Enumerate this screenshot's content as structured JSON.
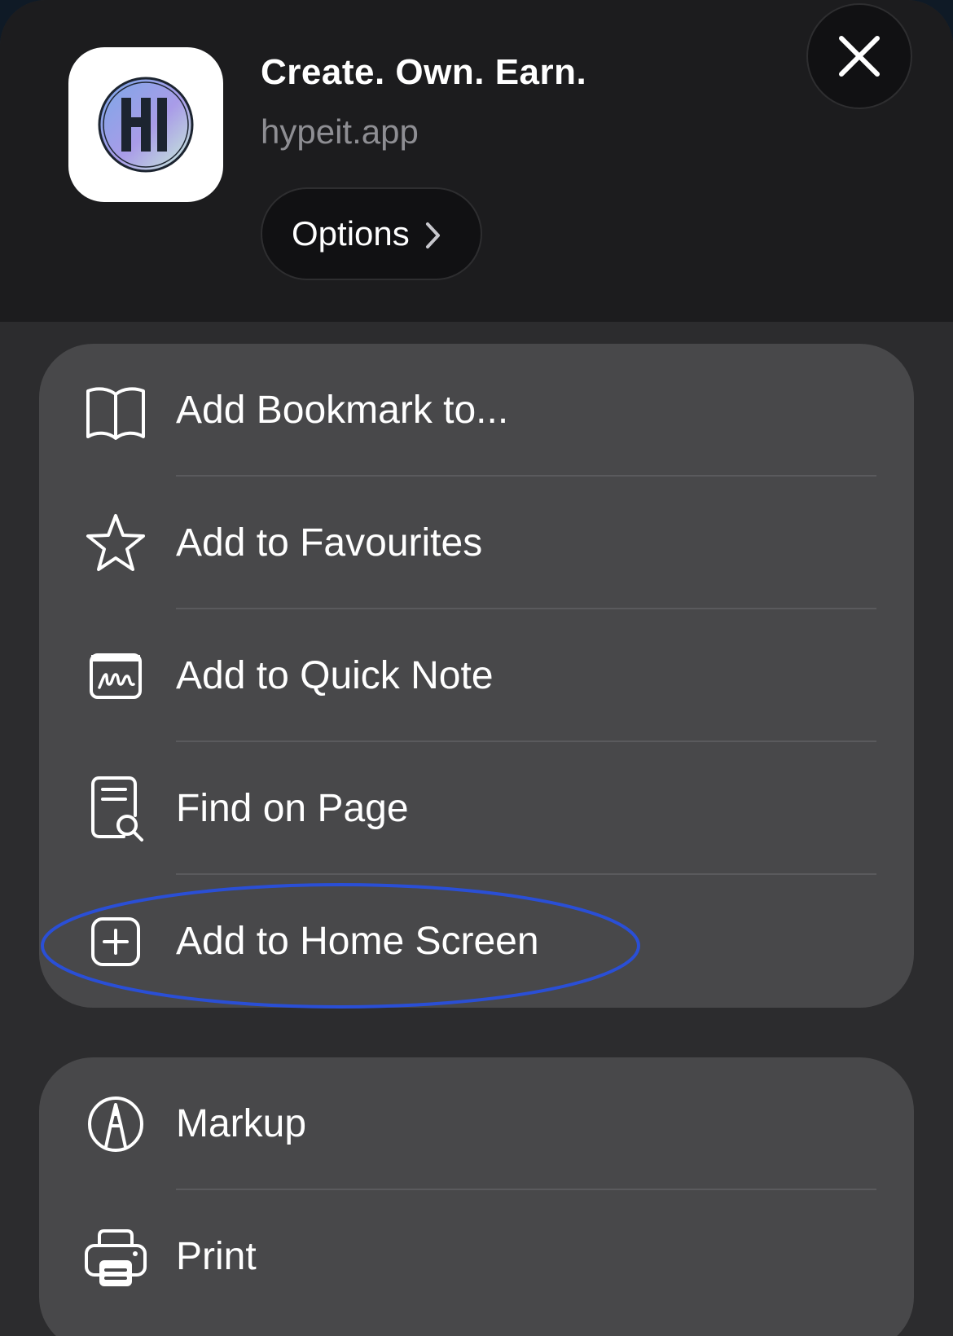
{
  "header": {
    "title": "Create. Own. Earn.",
    "subtitle": "hypeit.app",
    "options_label": "Options",
    "app_icon": "hypeit-logo-icon",
    "close_icon": "close-icon"
  },
  "menu_group_1": {
    "items": [
      {
        "label": "Add Bookmark to...",
        "icon": "book-icon"
      },
      {
        "label": "Add to Favourites",
        "icon": "star-icon"
      },
      {
        "label": "Add to Quick Note",
        "icon": "quick-note-icon"
      },
      {
        "label": "Find on Page",
        "icon": "find-on-page-icon"
      },
      {
        "label": "Add to Home Screen",
        "icon": "add-square-icon",
        "highlighted": true
      }
    ]
  },
  "menu_group_2": {
    "items": [
      {
        "label": "Markup",
        "icon": "markup-pen-icon"
      },
      {
        "label": "Print",
        "icon": "printer-icon"
      }
    ]
  },
  "colors": {
    "sheet_bg": "#2c2c2e",
    "header_bg": "#1c1c1e",
    "group_bg": "#48484a",
    "highlight": "#2a4fd6"
  }
}
